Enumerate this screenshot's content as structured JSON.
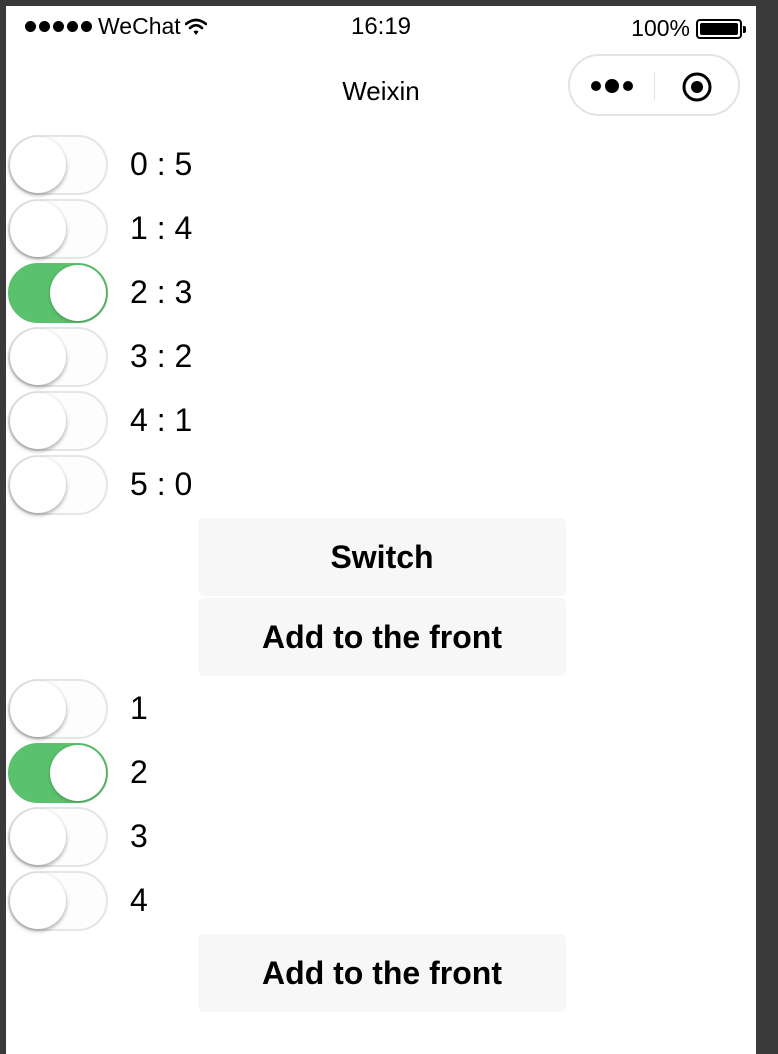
{
  "status_bar": {
    "carrier": "WeChat",
    "time": "16:19",
    "battery": "100%"
  },
  "nav": {
    "title": "Weixin"
  },
  "colors": {
    "switch_on": "#5ac16d",
    "button_bg": "#f7f7f7"
  },
  "list1": [
    {
      "label": "0 : 5",
      "checked": false
    },
    {
      "label": "1 : 4",
      "checked": false
    },
    {
      "label": "2 : 3",
      "checked": true
    },
    {
      "label": "3 : 2",
      "checked": false
    },
    {
      "label": "4 : 1",
      "checked": false
    },
    {
      "label": "5 : 0",
      "checked": false
    }
  ],
  "buttons": {
    "switch": "Switch",
    "add_front_1": "Add to the front",
    "add_front_2": "Add to the front"
  },
  "list2": [
    {
      "label": "1",
      "checked": false
    },
    {
      "label": "2",
      "checked": true
    },
    {
      "label": "3",
      "checked": false
    },
    {
      "label": "4",
      "checked": false
    }
  ]
}
